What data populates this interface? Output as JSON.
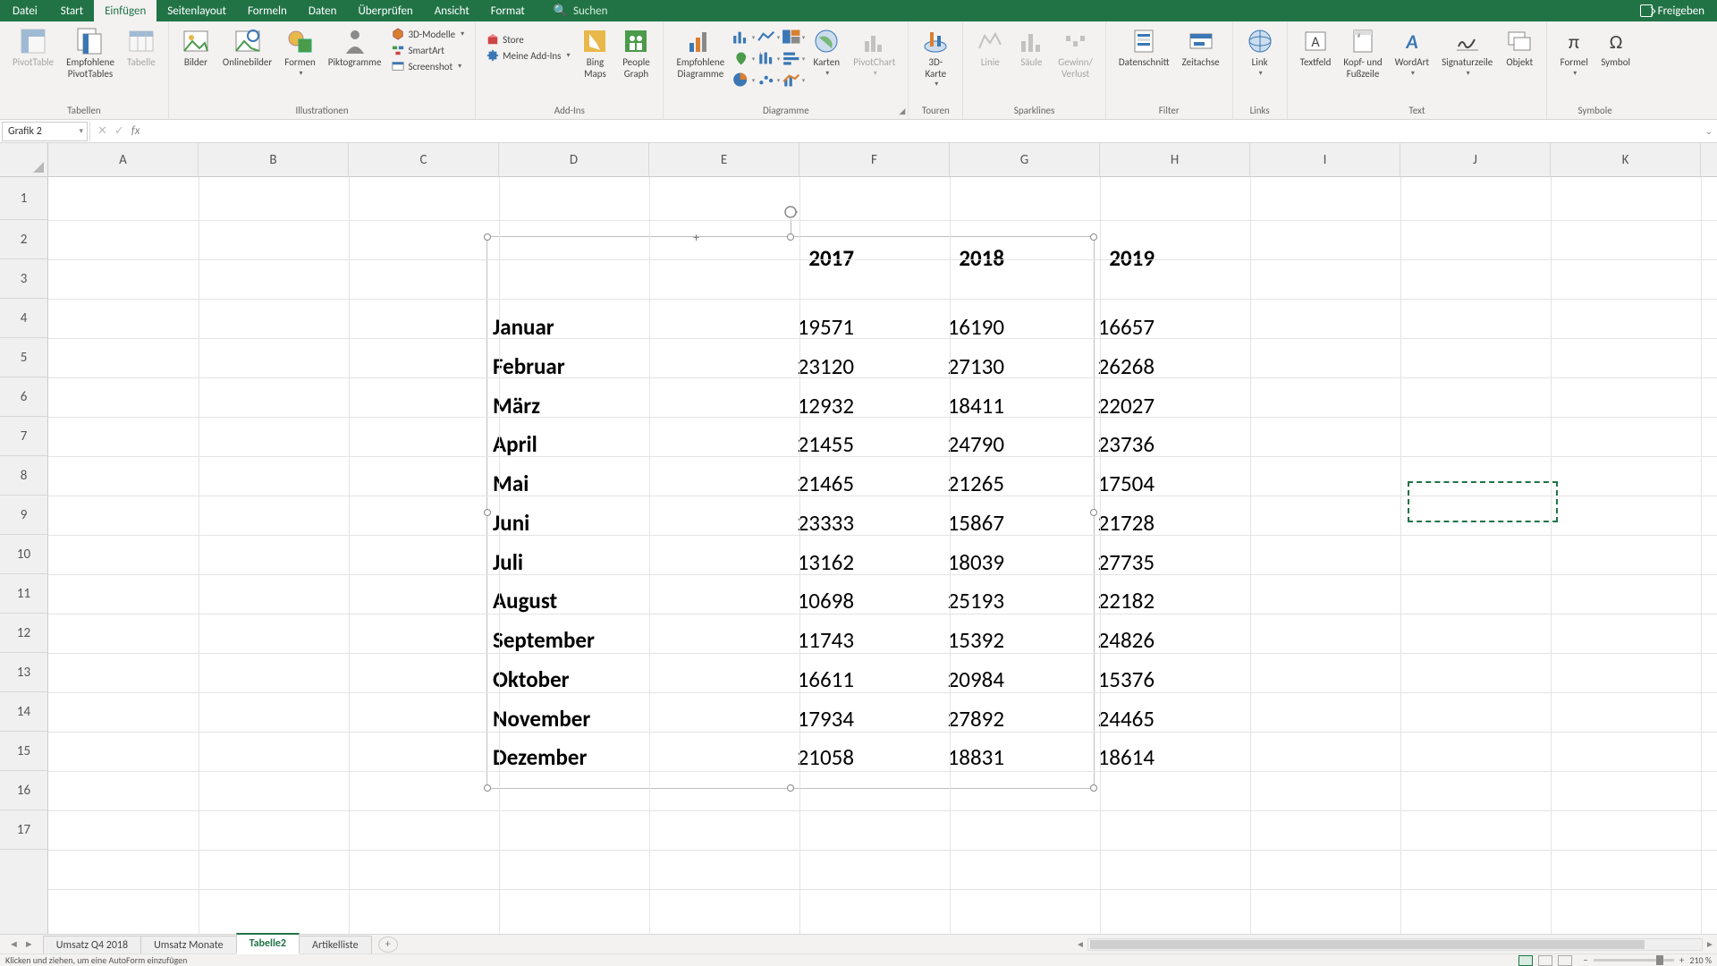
{
  "menu": {
    "file": "Datei",
    "tabs": [
      "Start",
      "Einfügen",
      "Seitenlayout",
      "Formeln",
      "Daten",
      "Überprüfen",
      "Ansicht",
      "Format"
    ],
    "active": "Einfügen",
    "search_placeholder": "Suchen",
    "share": "Freigeben"
  },
  "ribbon": {
    "groups": {
      "tabellen": {
        "label": "Tabellen",
        "pivot": "PivotTable",
        "recpivot": "Empfohlene\nPivotTables",
        "table": "Tabelle"
      },
      "illustrationen": {
        "label": "Illustrationen",
        "bilder": "Bilder",
        "online": "Onlinebilder",
        "formen": "Formen",
        "pikto": "Piktogramme",
        "models": "3D-Modelle",
        "smartart": "SmartArt",
        "screenshot": "Screenshot"
      },
      "addins": {
        "label": "Add-Ins",
        "store": "Store",
        "myaddins": "Meine Add-Ins",
        "bing": "Bing\nMaps",
        "people": "People\nGraph"
      },
      "diagramme": {
        "label": "Diagramme",
        "empfohlene": "Empfohlene\nDiagramme",
        "karten": "Karten",
        "pivotchart": "PivotChart"
      },
      "touren": {
        "label": "Touren",
        "btn": "3D-\nKarte"
      },
      "sparklines": {
        "label": "Sparklines",
        "linie": "Linie",
        "saule": "Säule",
        "gv": "Gewinn/\nVerlust"
      },
      "filter": {
        "label": "Filter",
        "ds": "Datenschnitt",
        "za": "Zeitachse"
      },
      "links": {
        "label": "Links",
        "link": "Link"
      },
      "text": {
        "label": "Text",
        "textfeld": "Textfeld",
        "kopf": "Kopf- und\nFußzeile",
        "wordart": "WordArt",
        "sig": "Signaturzeile",
        "obj": "Objekt"
      },
      "symbole": {
        "label": "Symbole",
        "formel": "Formel",
        "symbol": "Symbol"
      }
    }
  },
  "namebox": "Grafik 2",
  "formula": "",
  "columns": [
    "A",
    "B",
    "C",
    "D",
    "E",
    "F",
    "G",
    "H",
    "I",
    "J",
    "K"
  ],
  "rows": [
    "1",
    "2",
    "3",
    "4",
    "5",
    "6",
    "7",
    "8",
    "9",
    "10",
    "11",
    "12",
    "13",
    "14",
    "15",
    "16",
    "17"
  ],
  "chart_data": {
    "type": "table",
    "years": [
      "2017",
      "2018",
      "2019"
    ],
    "months": [
      "Januar",
      "Februar",
      "März",
      "April",
      "Mai",
      "Juni",
      "Juli",
      "August",
      "September",
      "Oktober",
      "November",
      "Dezember"
    ],
    "values": [
      [
        19571,
        16190,
        16657
      ],
      [
        23120,
        27130,
        26268
      ],
      [
        12932,
        18411,
        22027
      ],
      [
        21455,
        24790,
        23736
      ],
      [
        21465,
        21265,
        17504
      ],
      [
        23333,
        15867,
        21728
      ],
      [
        13162,
        18039,
        27735
      ],
      [
        10698,
        25193,
        22182
      ],
      [
        11743,
        15392,
        24826
      ],
      [
        16611,
        20984,
        15376
      ],
      [
        17934,
        27892,
        24465
      ],
      [
        21058,
        18831,
        18614
      ]
    ]
  },
  "sheets": {
    "tabs": [
      "Umsatz Q4 2018",
      "Umsatz Monate",
      "Tabelle2",
      "Artikelliste"
    ],
    "active": "Tabelle2"
  },
  "status": {
    "msg": "Klicken und ziehen, um eine AutoForm einzufügen",
    "zoom": "210 %"
  }
}
